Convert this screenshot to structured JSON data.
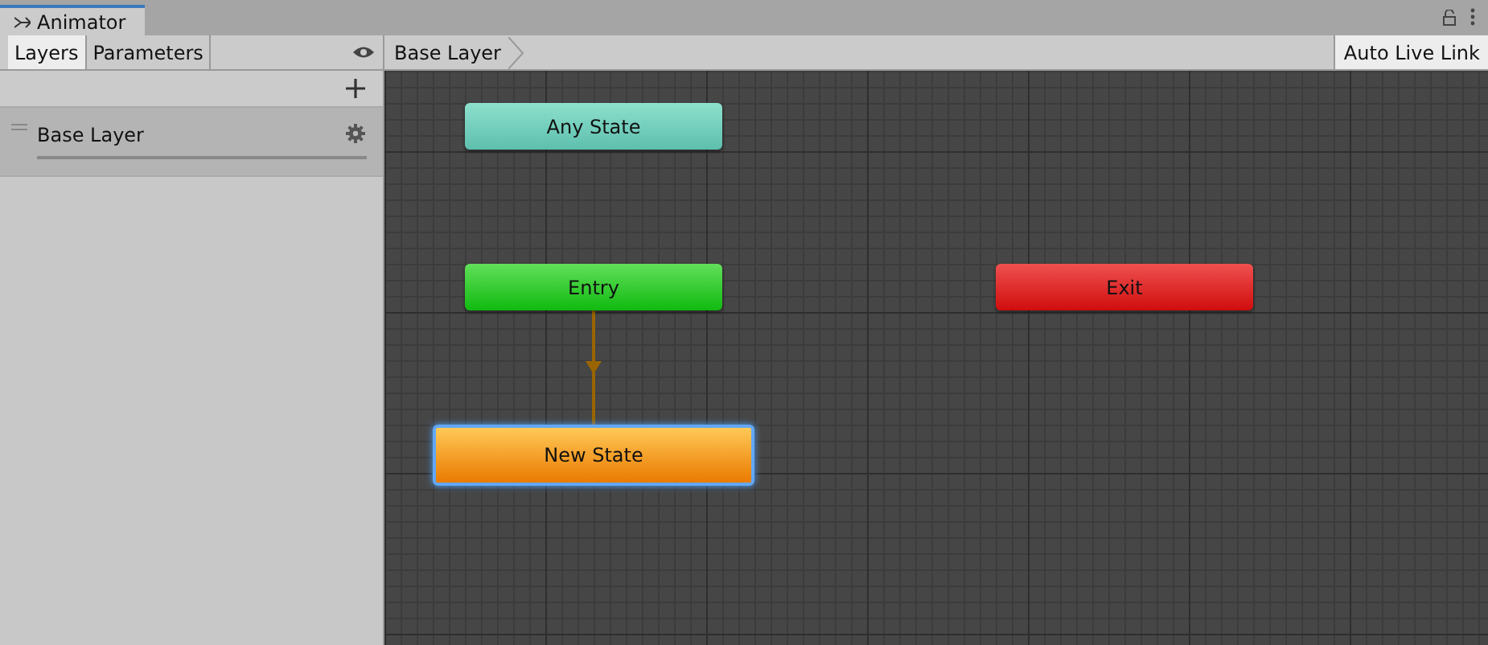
{
  "window": {
    "title": "Animator"
  },
  "panel_tabs": [
    {
      "label": "Layers",
      "selected": true
    },
    {
      "label": "Parameters",
      "selected": false
    }
  ],
  "layers": [
    {
      "name": "Base Layer",
      "selected": true
    }
  ],
  "breadcrumb": [
    "Base Layer"
  ],
  "auto_live_link": {
    "label": "Auto Live Link"
  },
  "nodes": [
    {
      "label": "Any State",
      "kind": "any",
      "selected": false,
      "transition_from_entry": false
    },
    {
      "label": "Entry",
      "kind": "entry",
      "selected": false,
      "transition_from_entry": false
    },
    {
      "label": "Exit",
      "kind": "exit",
      "selected": false,
      "transition_from_entry": false
    },
    {
      "label": "New State",
      "kind": "state",
      "selected": true,
      "transition_from_entry": true
    }
  ]
}
